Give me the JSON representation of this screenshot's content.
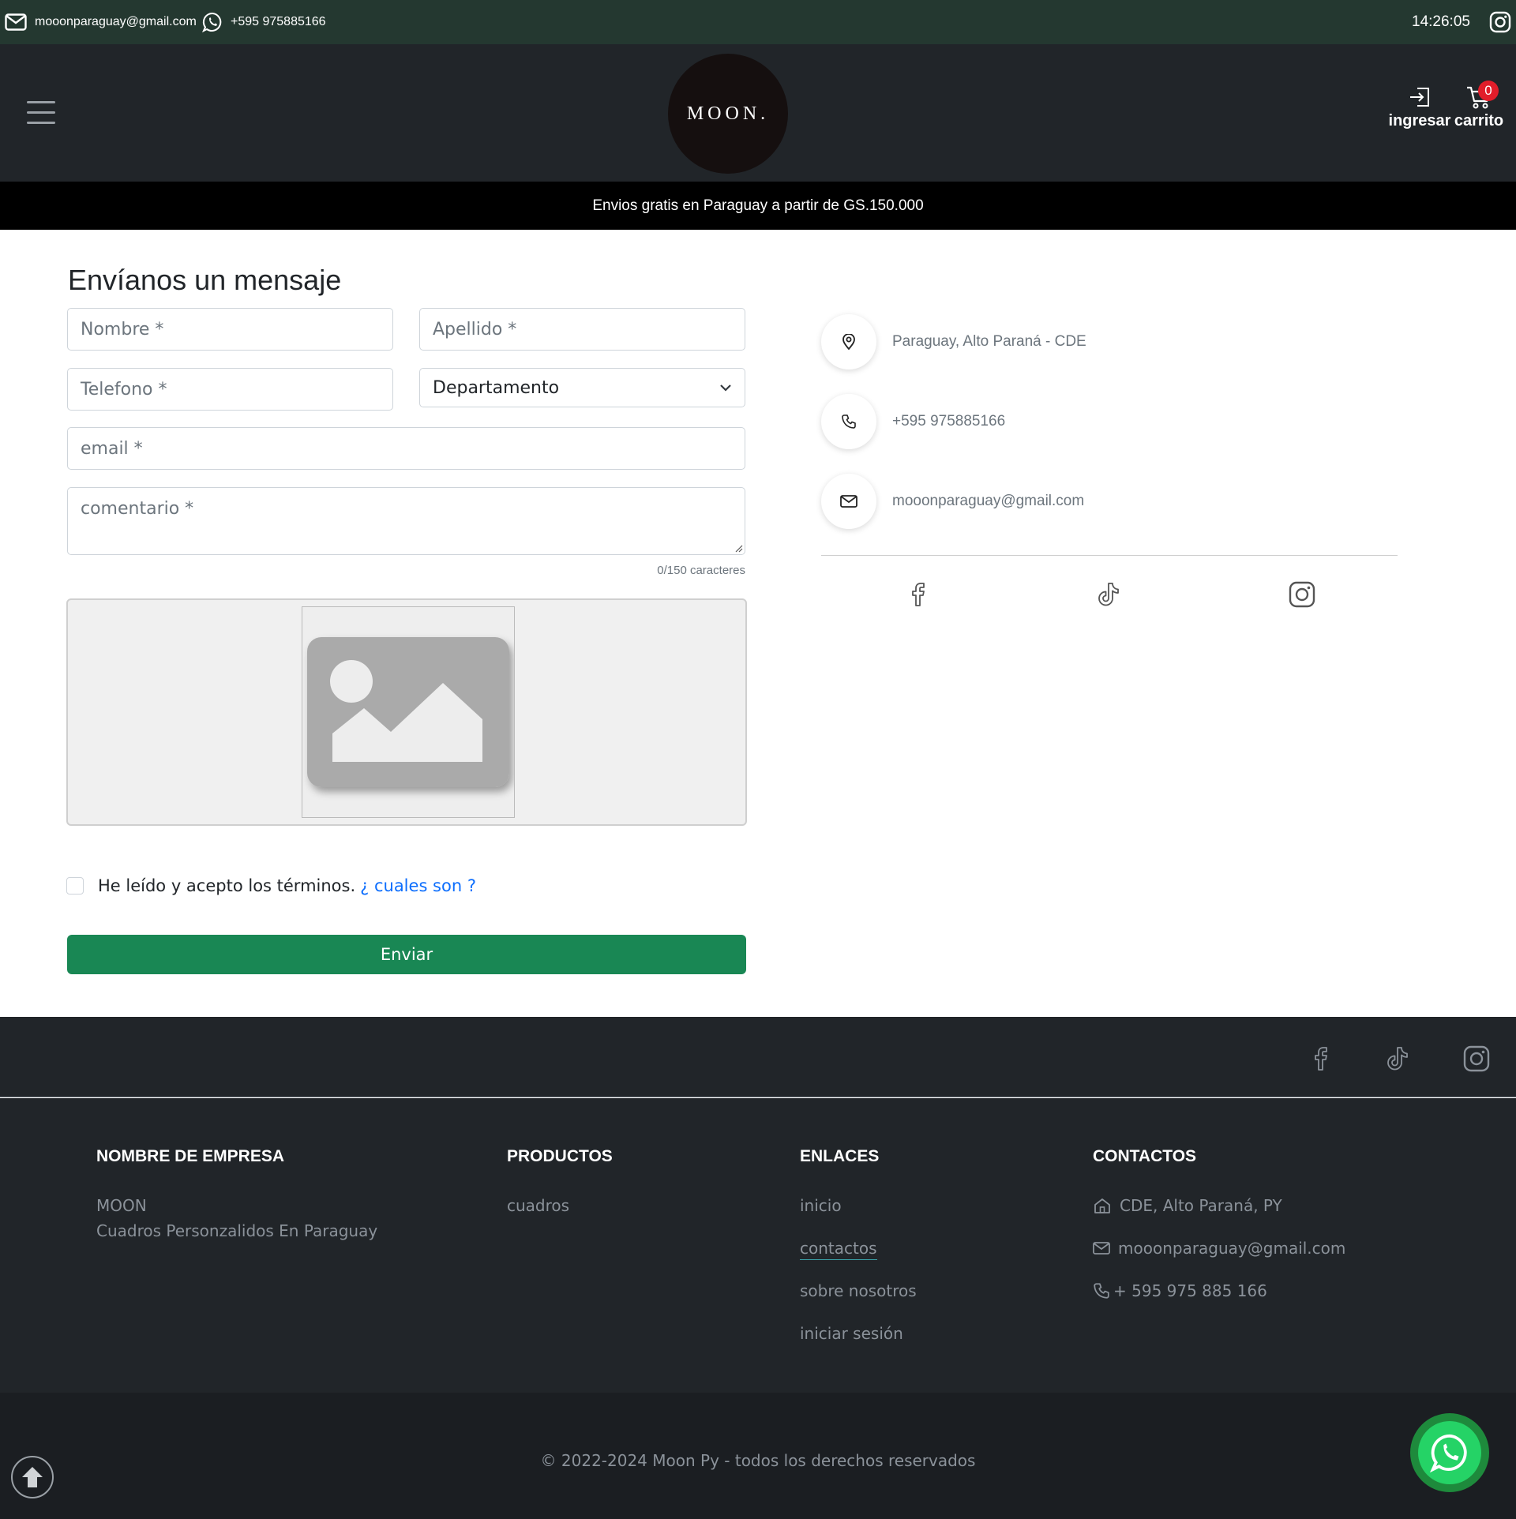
{
  "topbar": {
    "email": "mooonparaguay@gmail.com",
    "phone": "+595 975885166",
    "time": "14:26:05"
  },
  "header": {
    "logo_text": "MOON.",
    "login_label": "ingresar",
    "cart_label": "carrito",
    "cart_count": "0"
  },
  "banner": {
    "text": "Envios gratis en Paraguay a partir de GS.150.000"
  },
  "form": {
    "title": "Envíanos un mensaje",
    "nombre_placeholder": "Nombre *",
    "apellido_placeholder": "Apellido *",
    "telefono_placeholder": "Telefono *",
    "departamento_selected": "Departamento",
    "email_placeholder": "email *",
    "comentario_placeholder": "comentario *",
    "char_count": "0/150 caracteres",
    "terms_text": "He leído y acepto los términos.",
    "terms_link": "¿ cuales son ?",
    "submit_label": "Enviar"
  },
  "contact_info": {
    "address": "Paraguay, Alto Paraná - CDE",
    "phone": "+595 975885166",
    "email": "mooonparaguay@gmail.com"
  },
  "footer": {
    "company": {
      "heading": "NOMBRE DE EMPRESA",
      "name": "MOON",
      "tagline": "Cuadros Personzalidos En Paraguay"
    },
    "products": {
      "heading": "PRODUCTOS",
      "items": [
        "cuadros"
      ]
    },
    "links": {
      "heading": "ENLACES",
      "items": [
        "inicio",
        "contactos",
        "sobre nosotros",
        "iniciar sesión"
      ]
    },
    "contacts": {
      "heading": "CONTACTOS",
      "address": "CDE, Alto Paraná, PY",
      "email": "mooonparaguay@gmail.com",
      "phone": "+ 595 975 885 166"
    },
    "copyright": "© 2022-2024 Moon Py - todos los derechos reservados"
  },
  "colors": {
    "topbar_bg": "#243830",
    "header_bg": "#212529",
    "submit_green": "#198754",
    "whatsapp_green": "#25d366",
    "link_blue": "#0d6efd",
    "badge_red": "#e11d2a"
  },
  "icons": {
    "topbar": [
      "envelope-icon",
      "whatsapp-icon",
      "instagram-icon"
    ],
    "header": [
      "hamburger-icon",
      "login-icon",
      "cart-icon"
    ],
    "contact": [
      "location-icon",
      "phone-icon",
      "envelope-icon"
    ],
    "social": [
      "facebook-icon",
      "tiktok-icon",
      "instagram-icon"
    ],
    "footer": [
      "home-icon",
      "envelope-icon",
      "phone-icon",
      "arrow-up-icon",
      "whatsapp-icon"
    ]
  }
}
